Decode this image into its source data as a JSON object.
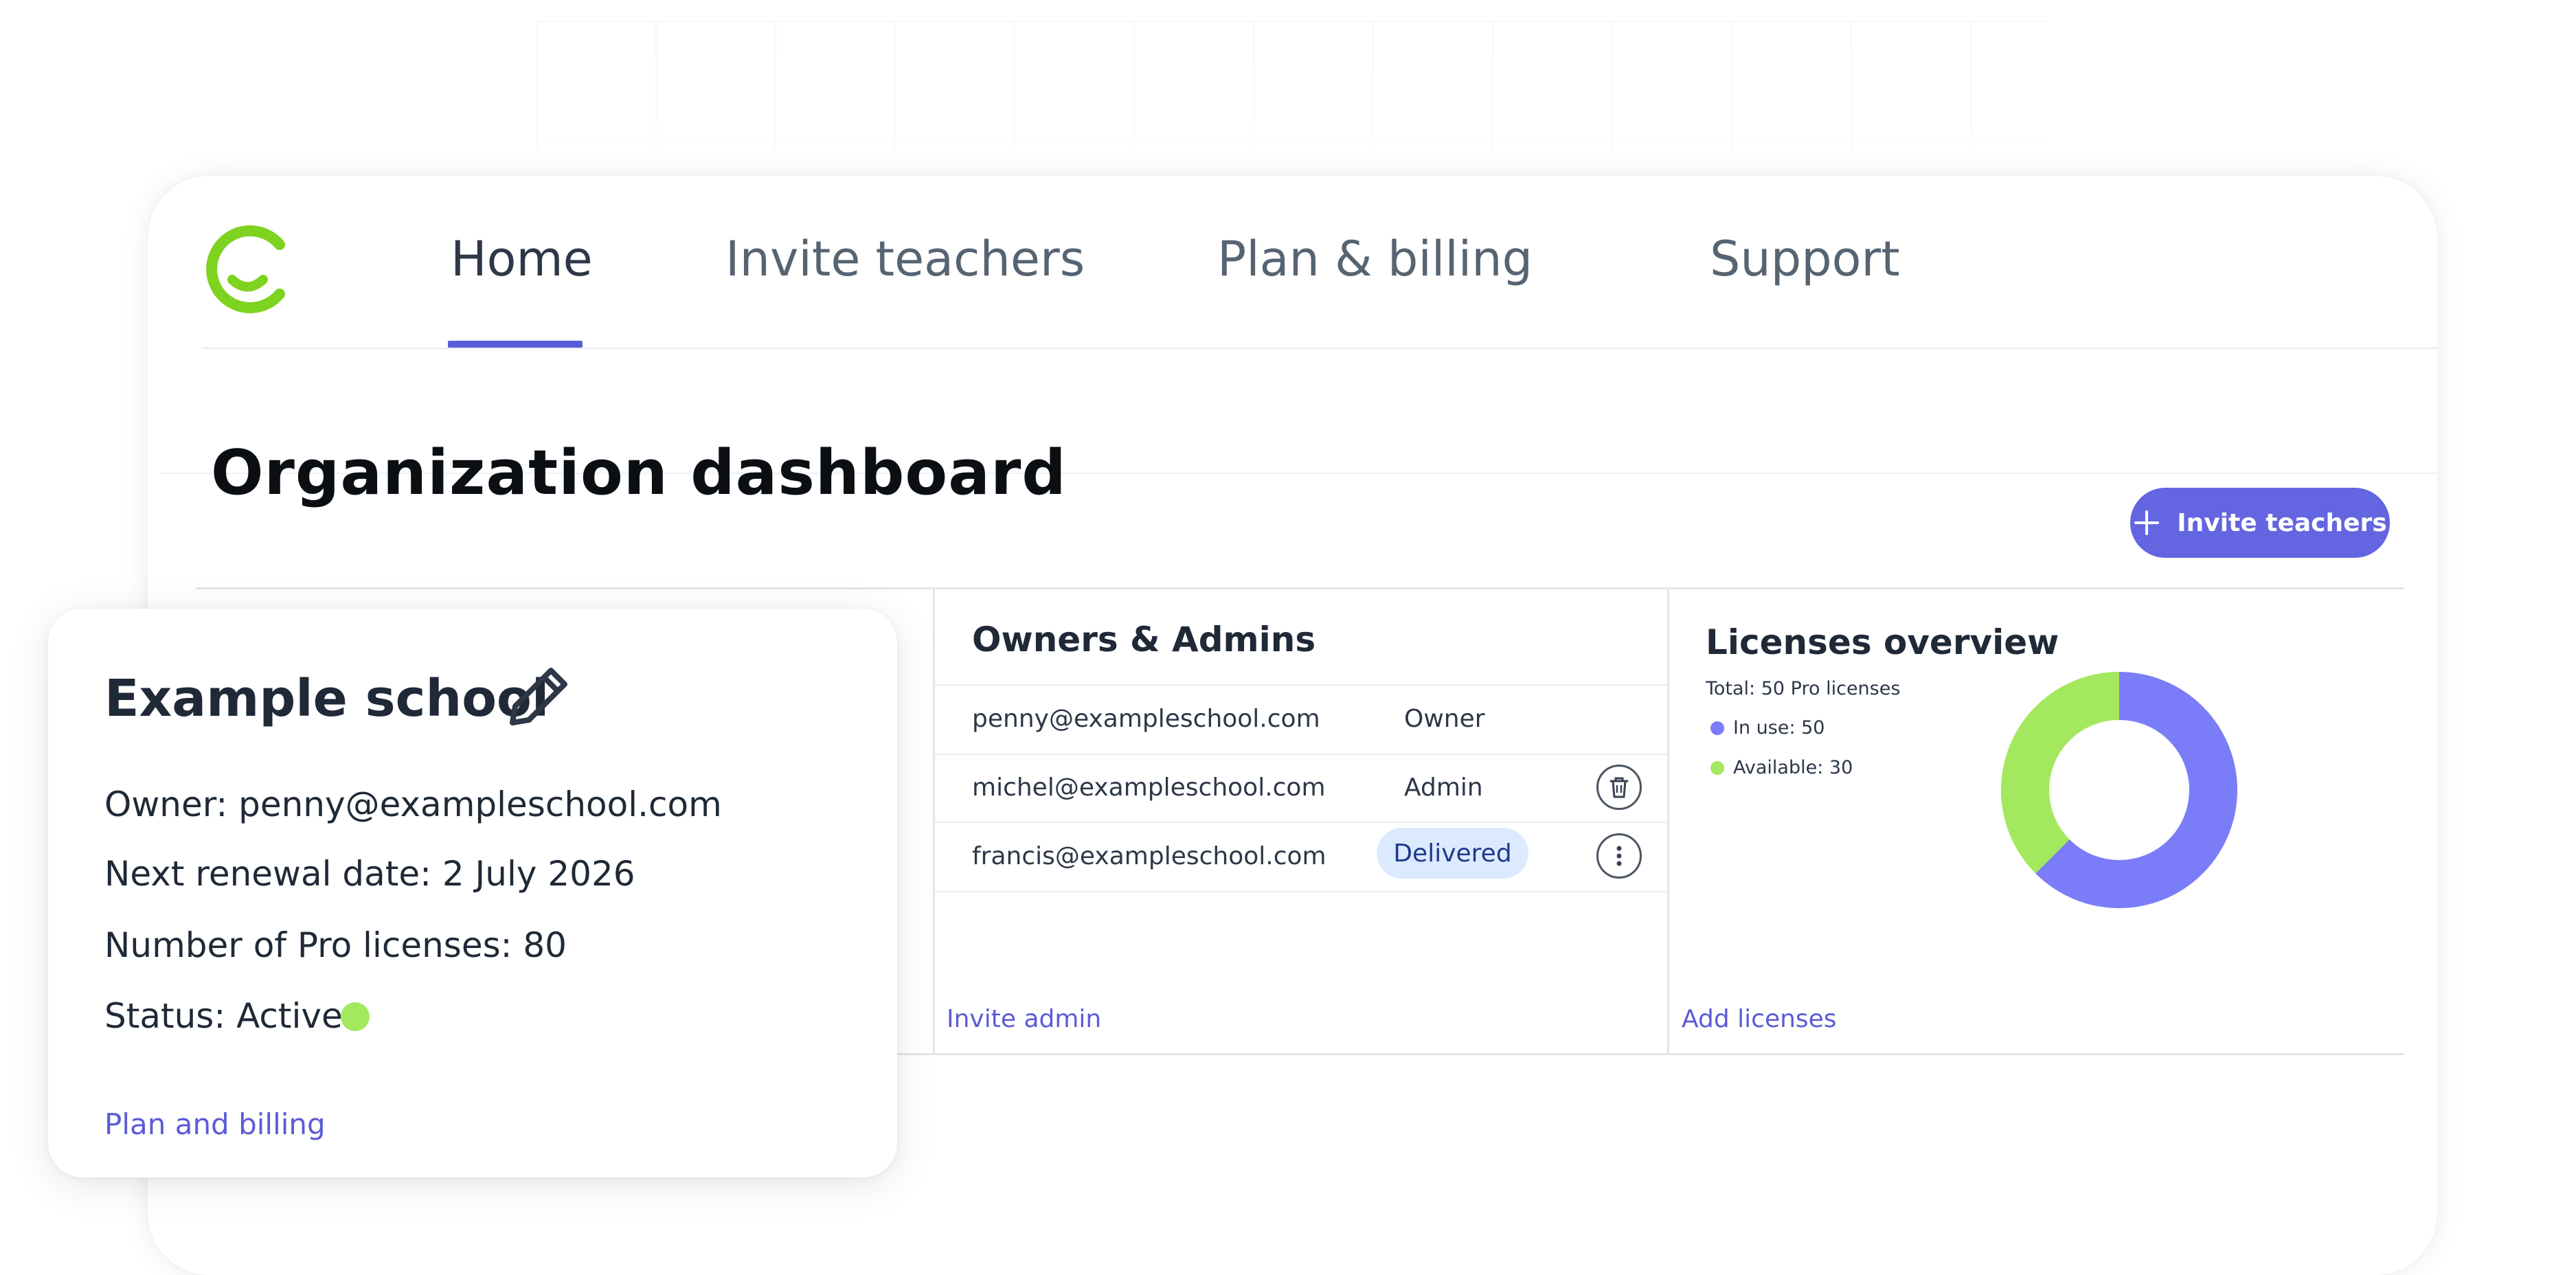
{
  "colors": {
    "accent": "#5b5bd6",
    "button": "#6366e0",
    "logo_green": "#7ed321",
    "in_use": "#7b7cf7",
    "available": "#a3e85e",
    "status_active": "#a3e85e"
  },
  "logo": {
    "icon": "smile-logo-icon"
  },
  "nav": {
    "tabs": [
      {
        "label": "Home",
        "active": true
      },
      {
        "label": "Invite teachers"
      },
      {
        "label": "Plan & billing"
      },
      {
        "label": "Support"
      }
    ]
  },
  "page": {
    "title": "Organization dashboard",
    "invite_button": {
      "label": "Invite teachers",
      "icon": "plus-icon"
    }
  },
  "owners_panel": {
    "title": "Owners & Admins",
    "rows": [
      {
        "email": "penny@exampleschool.com",
        "role": "Owner"
      },
      {
        "email": "michel@exampleschool.com",
        "role": "Admin",
        "action_icon": "trash-icon"
      },
      {
        "email": "francis@exampleschool.com",
        "role": "Delivered",
        "action_icon": "more-vertical-icon"
      }
    ],
    "link": "Invite admin"
  },
  "licenses_panel": {
    "title": "Licenses overview",
    "total": "Total: 50 Pro licenses",
    "legend": [
      {
        "label": "In use: 50",
        "value": 50
      },
      {
        "label": "Available: 30",
        "value": 30
      }
    ],
    "link": "Add licenses"
  },
  "school": {
    "name": "Example school",
    "edit_icon": "pencil-icon",
    "owner": "Owner: penny@exampleschool.com",
    "renewal": "Next renewal date: 2 July 2026",
    "licenses": "Number of Pro licenses: 80",
    "status": "Status: Active",
    "link": "Plan and billing"
  }
}
